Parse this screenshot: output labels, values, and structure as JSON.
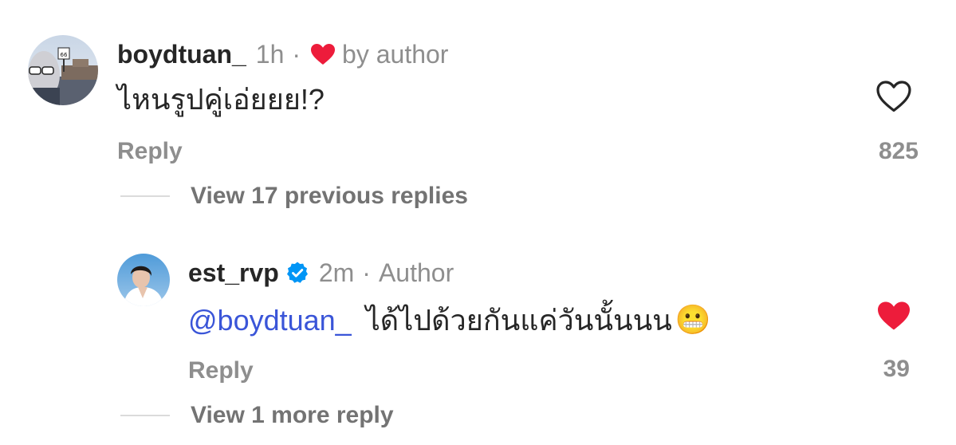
{
  "comments": [
    {
      "username": "boydtuan_",
      "time": "1h",
      "separator": "·",
      "liked_by_author_label": "by author",
      "text": "ไหนรูปคู่เอ่ยยย!?",
      "reply_label": "Reply",
      "like_count": "825",
      "liked": false,
      "view_replies_label": "View 17 previous replies"
    },
    {
      "username": "est_rvp",
      "verified": true,
      "time": "2m",
      "separator": "·",
      "author_label": "Author",
      "mention": "@boydtuan_",
      "text": "ได้ไปด้วยกันแค่วันนั้นนน",
      "emoji": "😬",
      "reply_label": "Reply",
      "like_count": "39",
      "liked": true,
      "view_replies_label": "View 1 more reply"
    }
  ],
  "colors": {
    "heart_red": "#ed1c3b",
    "verified_blue": "#0095f6",
    "mention_blue": "#3a55d8",
    "secondary_text": "#8e8e8e"
  }
}
